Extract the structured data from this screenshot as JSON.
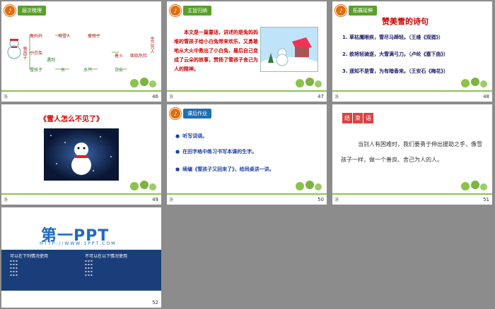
{
  "slides": [
    {
      "number": "46",
      "header": "层次梳理",
      "tree": {
        "root": "雪孩子",
        "nodes": [
          "兔妈妈",
          "堆雪人",
          "小白兔",
          "爱孩子",
          "雪孩子",
          "遇到",
          "水",
          "水汽",
          "白云",
          "家",
          "火",
          "救白兔",
          "着火",
          "冲进火",
          "飞上天空",
          "舍己为人",
          "面临危险"
        ]
      },
      "footer": "洛"
    },
    {
      "number": "47",
      "header": "主旨归纳",
      "paragraph": "本文是一篇童话，讲述的是兔妈妈堆的雪孩子给小白兔带来欢乐，又勇敢地从大火中救出了小白兔，最后自己变成了云朵的故事，赞扬了雪孩子舍己为人的精神。",
      "footer": "洛"
    },
    {
      "number": "48",
      "header": "拓展延伸",
      "title": "赞美雪的诗句",
      "lines": [
        "1. 草枯鹰眼疾，雪尽马蹄轻。（王维《观猎》）",
        "2. 欲将轻骑逐，大雪满弓刀。（卢纶《塞下曲》）",
        "3. 遥知不是雪，为有暗香来。（王安石《梅花》）"
      ],
      "footer": "洛"
    },
    {
      "number": "49",
      "title": "《雪人怎么不见了》",
      "footer": "洛"
    },
    {
      "number": "50",
      "header": "课后作业",
      "items": [
        "听写词语。",
        "在田字格中练习书写本课的生字。",
        "续编《雪孩子又回来了》，给同桌讲一讲。"
      ],
      "footer": "洛"
    },
    {
      "number": "51",
      "tag": [
        "结",
        "束",
        "语"
      ],
      "body": "当别人有困难时，我们要勇于伸出援助之手，像雪孩子一样，做一个善良、舍己为人的人。",
      "footer": "洛"
    },
    {
      "number": "52",
      "logo": "第一PPT",
      "url": "HTTP://WWW.1PPT.COM",
      "col1_title": "可以在下列情况使用",
      "col2_title": "不可以在以下情况使用"
    }
  ],
  "colors": {
    "accent_red": "#d00000",
    "accent_blue": "#1f3fa8",
    "green": "#5aa02c"
  }
}
